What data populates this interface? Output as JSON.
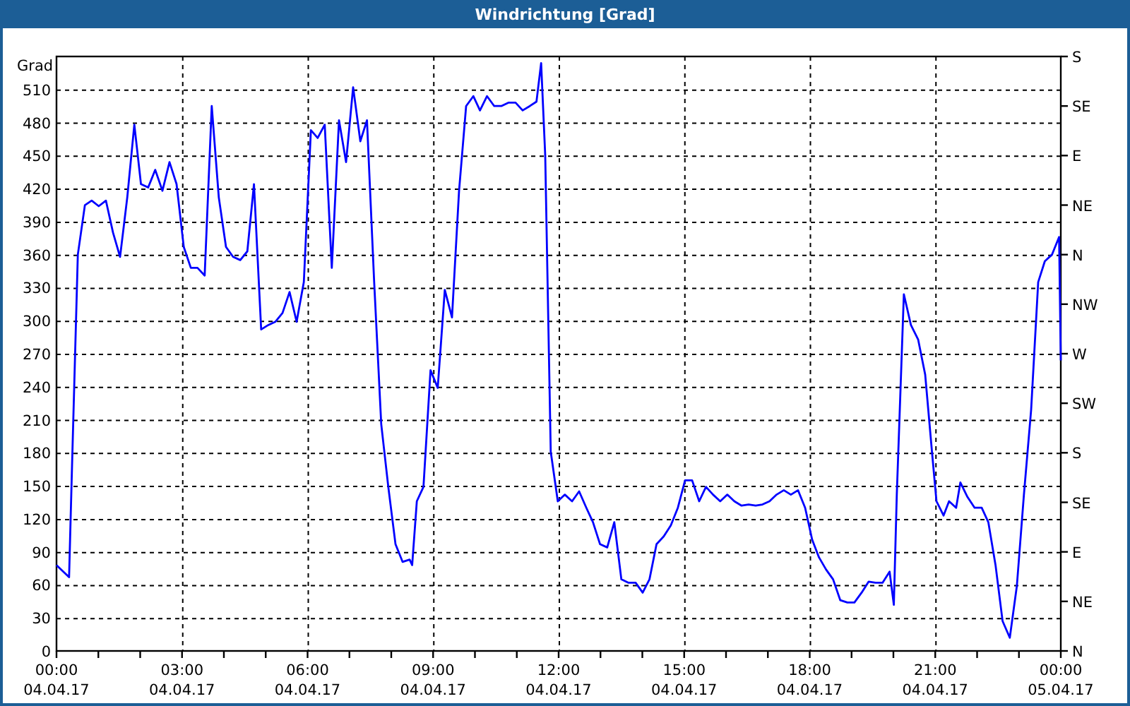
{
  "window": {
    "title": "Windrichtung [Grad]"
  },
  "chart": {
    "chart_data": {
      "type": "line",
      "ylabel": "Grad",
      "x": [
        0,
        0.3,
        0.37,
        0.51,
        0.68,
        0.84,
        1.01,
        1.18,
        1.35,
        1.52,
        1.69,
        1.86,
        2.02,
        2.19,
        2.36,
        2.53,
        2.7,
        2.87,
        3.04,
        3.21,
        3.37,
        3.54,
        3.71,
        3.88,
        4.05,
        4.22,
        4.39,
        4.56,
        4.72,
        4.89,
        5.06,
        5.23,
        5.4,
        5.57,
        5.74,
        5.91,
        6.08,
        6.24,
        6.41,
        6.58,
        6.75,
        6.92,
        7.09,
        7.26,
        7.42,
        7.59,
        7.76,
        7.93,
        8.1,
        8.27,
        8.44,
        8.5,
        8.61,
        8.77,
        8.94,
        9.11,
        9.28,
        9.45,
        9.62,
        9.79,
        9.96,
        10.12,
        10.29,
        10.46,
        10.63,
        10.8,
        10.97,
        11.14,
        11.31,
        11.47,
        11.58,
        11.68,
        11.81,
        11.98,
        12.15,
        12.32,
        12.49,
        12.66,
        12.82,
        12.99,
        13.16,
        13.33,
        13.5,
        13.67,
        13.84,
        14.01,
        14.17,
        14.34,
        14.51,
        14.68,
        14.85,
        15.02,
        15.19,
        15.36,
        15.52,
        15.69,
        15.86,
        16.03,
        16.2,
        16.37,
        16.54,
        16.71,
        16.87,
        17.04,
        17.21,
        17.38,
        17.55,
        17.72,
        17.89,
        18.06,
        18.22,
        18.39,
        18.56,
        18.73,
        18.9,
        19.07,
        19.24,
        19.41,
        19.57,
        19.74,
        19.91,
        20.01,
        20.08,
        20.25,
        20.42,
        20.59,
        20.76,
        20.92,
        21.03,
        21.2,
        21.33,
        21.5,
        21.6,
        21.77,
        21.94,
        22.11,
        22.27,
        22.44,
        22.61,
        22.78,
        22.95,
        23.12,
        23.29,
        23.46,
        23.62,
        23.79,
        23.96,
        24
      ],
      "series": [
        {
          "color": "#0000ff",
          "values": [
            78,
            67,
            168,
            360,
            405,
            409,
            404,
            409,
            380,
            358,
            412,
            478,
            424,
            421,
            437,
            418,
            444,
            424,
            367,
            348,
            348,
            341,
            495,
            412,
            367,
            358,
            355,
            363,
            424,
            292,
            296,
            299,
            307,
            326,
            299,
            335,
            473,
            466,
            478,
            348,
            482,
            444,
            512,
            463,
            482,
            335,
            206,
            149,
            97,
            81,
            83,
            78,
            136,
            149,
            255,
            239,
            328,
            303,
            418,
            495,
            504,
            491,
            504,
            495,
            495,
            498,
            498,
            491,
            495,
            499,
            534,
            450,
            181,
            136,
            142,
            136,
            145,
            130,
            117,
            97,
            94,
            117,
            65,
            62,
            62,
            53,
            65,
            97,
            104,
            114,
            130,
            155,
            155,
            136,
            149,
            142,
            136,
            142,
            136,
            132,
            133,
            132,
            133,
            136,
            142,
            146,
            142,
            146,
            130,
            101,
            85,
            74,
            65,
            46,
            44,
            44,
            53,
            63,
            62,
            62,
            72,
            42,
            142,
            324,
            296,
            283,
            251,
            181,
            136,
            123,
            136,
            130,
            153,
            140,
            130,
            130,
            117,
            78,
            27,
            12,
            59,
            142,
            219,
            335,
            354,
            360,
            376,
            264
          ]
        }
      ],
      "xlim": [
        0,
        24
      ],
      "ylim": [
        0,
        540
      ],
      "grid": true,
      "xticks": [
        {
          "value": 0,
          "label": "00:00"
        },
        {
          "value": 3,
          "label": "03:00"
        },
        {
          "value": 6,
          "label": "06:00"
        },
        {
          "value": 9,
          "label": "09:00"
        },
        {
          "value": 12,
          "label": "12:00"
        },
        {
          "value": 15,
          "label": "15:00"
        },
        {
          "value": 18,
          "label": "18:00"
        },
        {
          "value": 21,
          "label": "21:00"
        },
        {
          "value": 24,
          "label": "00:00"
        }
      ],
      "yticks": [
        0,
        30,
        60,
        90,
        120,
        150,
        180,
        210,
        240,
        270,
        300,
        330,
        360,
        390,
        420,
        450,
        480,
        510
      ]
    },
    "xtick_dates": [
      "04.04.17",
      "04.04.17",
      "04.04.17",
      "04.04.17",
      "04.04.17",
      "04.04.17",
      "04.04.17",
      "04.04.17",
      "05.04.17"
    ],
    "right_axis": [
      "S",
      "SE",
      "E",
      "NE",
      "N",
      "NW",
      "W",
      "SW",
      "S",
      "SE",
      "E",
      "NE",
      "N"
    ]
  }
}
